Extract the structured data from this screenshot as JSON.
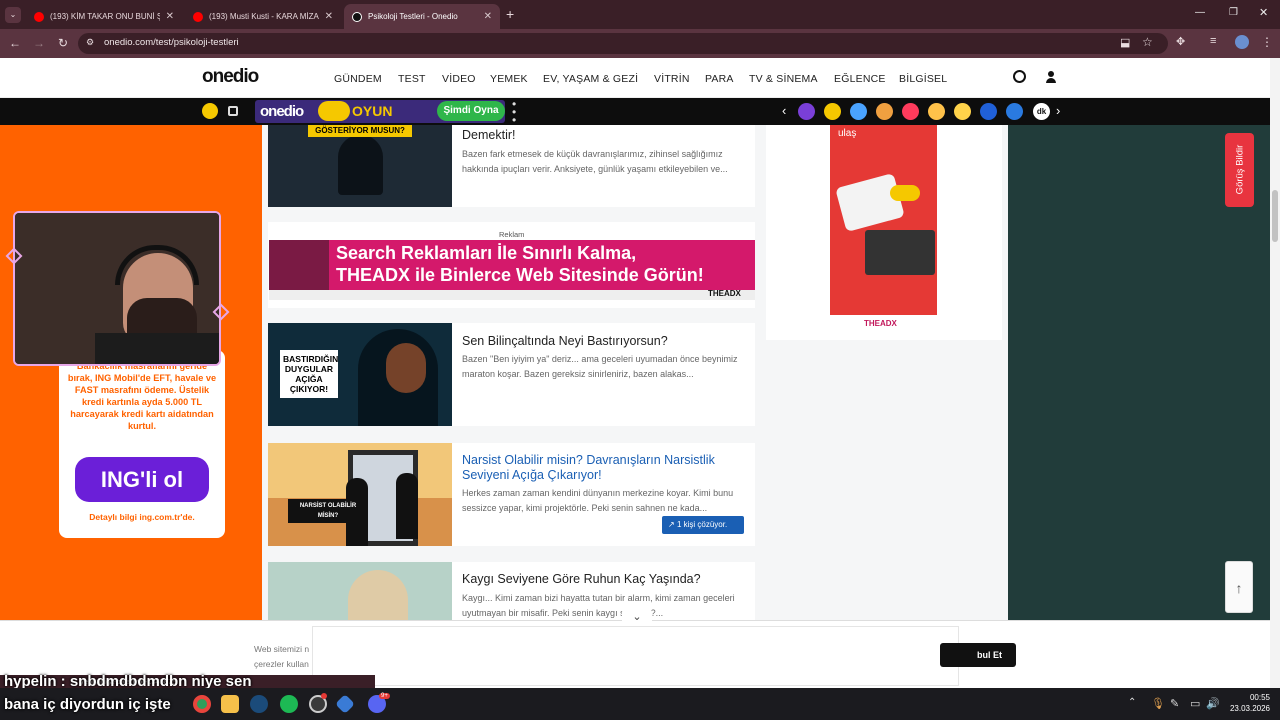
{
  "browser": {
    "tabs": [
      {
        "label": "(193) KİM TAKAR ONU BUNİ ŞA"
      },
      {
        "label": "(193) Musti Kusti - KARA MİZA"
      },
      {
        "label": "Psikoloji Testleri - Onedio"
      }
    ],
    "new_tab": "+",
    "url": "onedio.com/test/psikoloji-testleri"
  },
  "site": {
    "logo": "onedio",
    "menu": [
      "GÜNDEM",
      "TEST",
      "VİDEO",
      "YEMEK",
      "EV, YAŞAM & GEZİ",
      "VİTRİN",
      "PARA",
      "TV & SİNEMA",
      "EĞLENCE",
      "BİLGİSEL"
    ]
  },
  "gamebar": {
    "logo": "onedio",
    "label": "OYUN",
    "play": "Şimdi Oyna",
    "dk": "dk"
  },
  "cards": [
    {
      "title": "Demektir!",
      "desc": "Bazen fark etmesek de küçük davranışlarımız, zihinsel sağlığımız hakkında ipuçları verir. Anksiyete, günlük yaşamı etkileyebilen ve...",
      "overlay": "GÖSTERİYOR MUSUN?"
    },
    {
      "title": "Sen Bilinçaltında Neyi Bastırıyorsun?",
      "desc": "Bazen \"Ben iyiyim ya\" deriz... ama geceleri uyumadan önce beynimiz maraton koşar. Bazen gereksiz sinirleniriz, bazen alakas...",
      "overlay": "BASTIRDIĞIN DUYGULAR AÇIĞA ÇIKIYOR!"
    },
    {
      "title": "Narsist Olabilir misin? Davranışların Narsistlik Seviyeni Açığa Çıkarıyor!",
      "desc": "Herkes zaman zaman kendini dünyanın merkezine koyar. Kimi bunu sessizce yapar, kimi projektörle. Peki senin sahnen ne kada...",
      "overlay": "NARSİST OLABİLİR MİSİN?",
      "badge": "1 kişi çözüyor."
    },
    {
      "title": "Kaygı Seviyene Göre Ruhun Kaç Yaşında?",
      "desc": "Kaygı... Kimi zaman bizi hayatta tutan bir alarm, kimi zaman geceleri uyutmayan bir misafir. Peki senin kaygı seviyen?..."
    }
  ],
  "ad": {
    "label": "Reklam",
    "line1": "Search Reklamları İle Sınırlı Kalma,",
    "line2": "THEADX ile Binlerce Web Sitesinde Görün!",
    "brand": "THEADX",
    "side_top": "ulaş",
    "side_brand": "THEADX"
  },
  "ing": {
    "text": "Bankacılık masraflarını geride bırak, ING Mobil'de EFT, havale ve FAST masrafını ödeme. Üstelik kredi kartınla ayda 5.000 TL harcayarak kredi kartı aidatından kurtul.",
    "button": "ING'li ol",
    "small": "Detaylı bilgi ing.com.tr'de."
  },
  "side": {
    "feedback": "Görüş Bildir",
    "backtop": "↑"
  },
  "cookie": {
    "line1": "Web sitemizi n",
    "line2": "çerezler kullan",
    "accept": "bul Et"
  },
  "status_url": "yeni-aciga-cikariyor-1345875",
  "chat": {
    "line1": "hypelin : snbdmdbdmdbn niye sen",
    "line2": "bana iç diyordun iç işte"
  },
  "taskbar": {
    "time": "00:55",
    "date": "23.03.2026",
    "discord_badge": "9+"
  },
  "colors": {
    "onedio_orange": "#ff6200",
    "ing_purple": "#6b1fd8",
    "theadx_pink": "#d4196b",
    "feedback_red": "#e8343f",
    "link_blue": "#1a5fb4"
  }
}
